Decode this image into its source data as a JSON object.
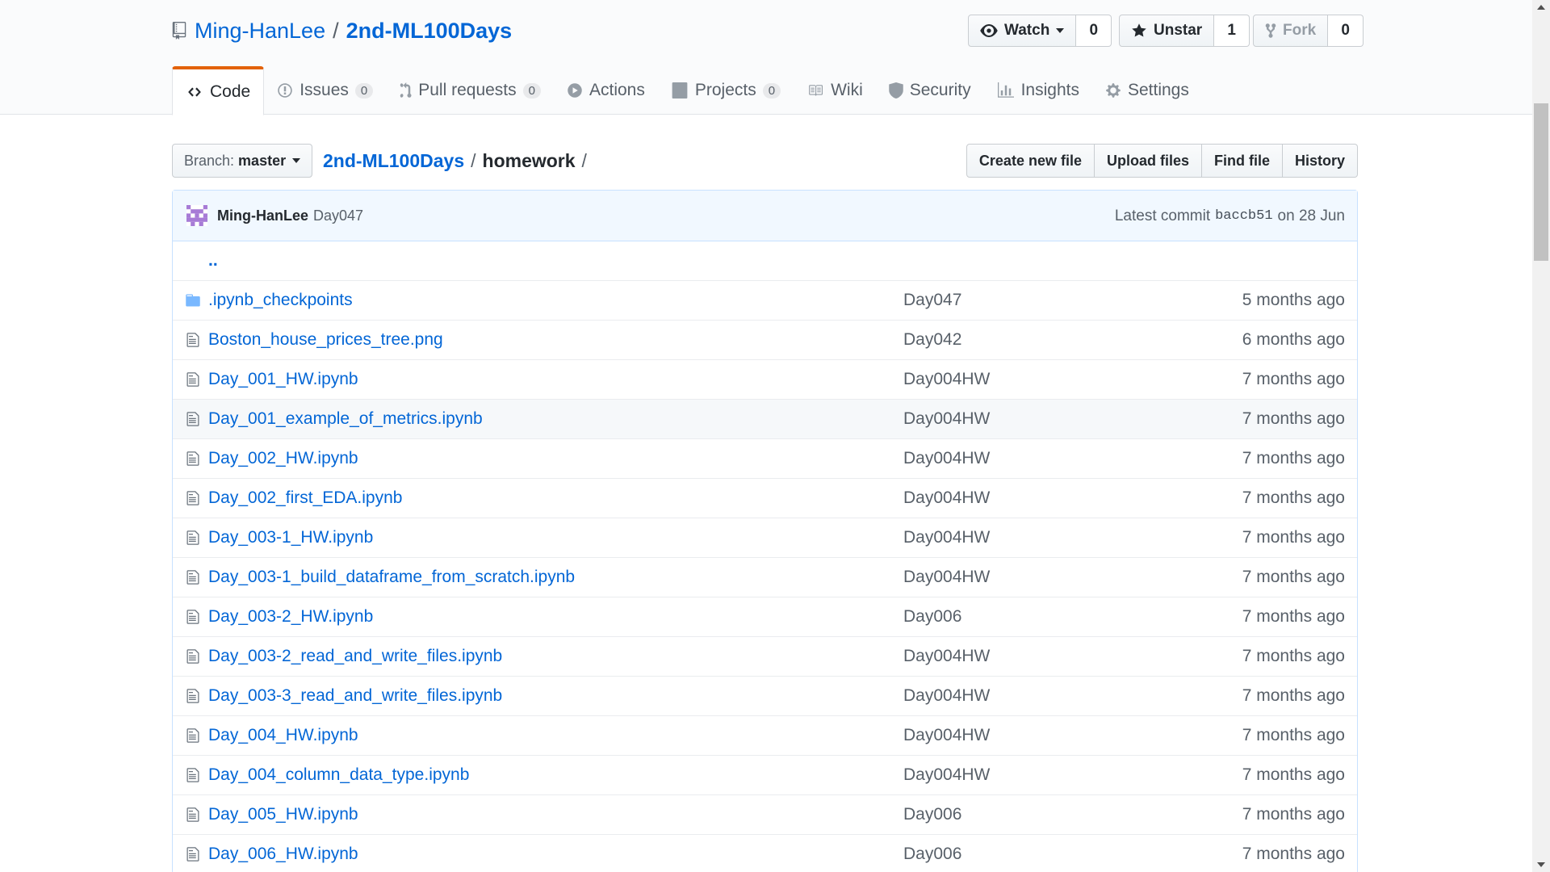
{
  "repo": {
    "owner": "Ming-HanLee",
    "separator": "/",
    "name": "2nd-ML100Days"
  },
  "actions": {
    "watch": {
      "label": "Watch",
      "count": "0"
    },
    "star": {
      "label": "Unstar",
      "count": "1"
    },
    "fork": {
      "label": "Fork",
      "count": "0"
    }
  },
  "tabs": [
    {
      "label": "Code",
      "icon": "code-icon"
    },
    {
      "label": "Issues",
      "icon": "issue-icon",
      "count": "0"
    },
    {
      "label": "Pull requests",
      "icon": "pull-request-icon",
      "count": "0"
    },
    {
      "label": "Actions",
      "icon": "play-icon"
    },
    {
      "label": "Projects",
      "icon": "project-icon",
      "count": "0"
    },
    {
      "label": "Wiki",
      "icon": "book-icon"
    },
    {
      "label": "Security",
      "icon": "shield-icon"
    },
    {
      "label": "Insights",
      "icon": "graph-icon"
    },
    {
      "label": "Settings",
      "icon": "gear-icon"
    }
  ],
  "branch": {
    "prefix": "Branch:",
    "name": "master"
  },
  "breadcrumb": {
    "root": "2nd-ML100Days",
    "sep": "/",
    "current": "homework",
    "trail": "/"
  },
  "file_buttons": {
    "create": "Create new file",
    "upload": "Upload files",
    "find": "Find file",
    "history": "History"
  },
  "commit": {
    "author": "Ming-HanLee",
    "message": "Day047",
    "latest_prefix": "Latest commit",
    "sha": "baccb51",
    "date": "on 28 Jun"
  },
  "files": {
    "up": "..",
    "rows": [
      {
        "name": ".ipynb_checkpoints",
        "type": "folder",
        "message": "Day047",
        "age": "5 months ago"
      },
      {
        "name": "Boston_house_prices_tree.png",
        "type": "file",
        "message": "Day042",
        "age": "6 months ago"
      },
      {
        "name": "Day_001_HW.ipynb",
        "type": "file",
        "message": "Day004HW",
        "age": "7 months ago"
      },
      {
        "name": "Day_001_example_of_metrics.ipynb",
        "type": "file",
        "message": "Day004HW",
        "age": "7 months ago"
      },
      {
        "name": "Day_002_HW.ipynb",
        "type": "file",
        "message": "Day004HW",
        "age": "7 months ago"
      },
      {
        "name": "Day_002_first_EDA.ipynb",
        "type": "file",
        "message": "Day004HW",
        "age": "7 months ago"
      },
      {
        "name": "Day_003-1_HW.ipynb",
        "type": "file",
        "message": "Day004HW",
        "age": "7 months ago"
      },
      {
        "name": "Day_003-1_build_dataframe_from_scratch.ipynb",
        "type": "file",
        "message": "Day004HW",
        "age": "7 months ago"
      },
      {
        "name": "Day_003-2_HW.ipynb",
        "type": "file",
        "message": "Day006",
        "age": "7 months ago"
      },
      {
        "name": "Day_003-2_read_and_write_files.ipynb",
        "type": "file",
        "message": "Day004HW",
        "age": "7 months ago"
      },
      {
        "name": "Day_003-3_read_and_write_files.ipynb",
        "type": "file",
        "message": "Day004HW",
        "age": "7 months ago"
      },
      {
        "name": "Day_004_HW.ipynb",
        "type": "file",
        "message": "Day004HW",
        "age": "7 months ago"
      },
      {
        "name": "Day_004_column_data_type.ipynb",
        "type": "file",
        "message": "Day004HW",
        "age": "7 months ago"
      },
      {
        "name": "Day_005_HW.ipynb",
        "type": "file",
        "message": "Day006",
        "age": "7 months ago"
      },
      {
        "name": "Day_006_HW.ipynb",
        "type": "file",
        "message": "Day006",
        "age": "7 months ago"
      }
    ]
  },
  "colors": {
    "link": "#0366d6",
    "tab_accent": "#e36209",
    "commit_bg": "#f1f8ff",
    "folder": "#79b8ff"
  }
}
